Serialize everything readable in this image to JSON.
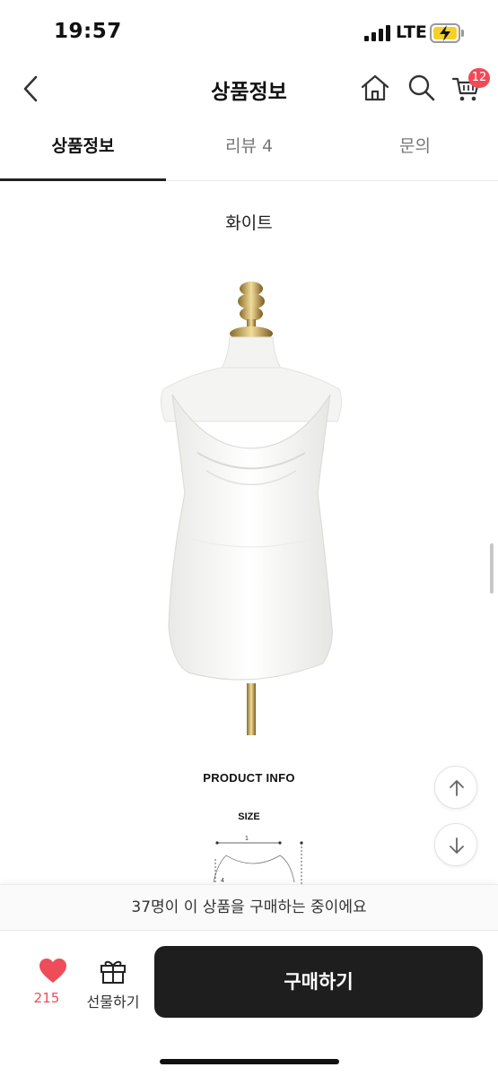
{
  "status_bar": {
    "time": "19:57",
    "network": "LTE"
  },
  "header": {
    "title": "상품정보",
    "cart_count": "12",
    "icons": [
      "back-icon",
      "home-icon",
      "search-icon",
      "cart-icon"
    ]
  },
  "tabs": [
    {
      "label": "상품정보",
      "active": true
    },
    {
      "label": "리뷰 4",
      "active": false
    },
    {
      "label": "문의",
      "active": false
    }
  ],
  "content": {
    "color_label": "화이트",
    "product_info_title": "PRODUCT INFO",
    "size_title": "SIZE",
    "size_marks": [
      "1",
      "4"
    ]
  },
  "purchase_notice": "37명이 이 상품을 구매하는 중이에요",
  "bottom_bar": {
    "like_count": "215",
    "gift_label": "선물하기",
    "buy_label": "구매하기"
  },
  "colors": {
    "accent": "#f04a58",
    "buy_button": "#1e1e1e",
    "battery": "#f4d02a"
  }
}
